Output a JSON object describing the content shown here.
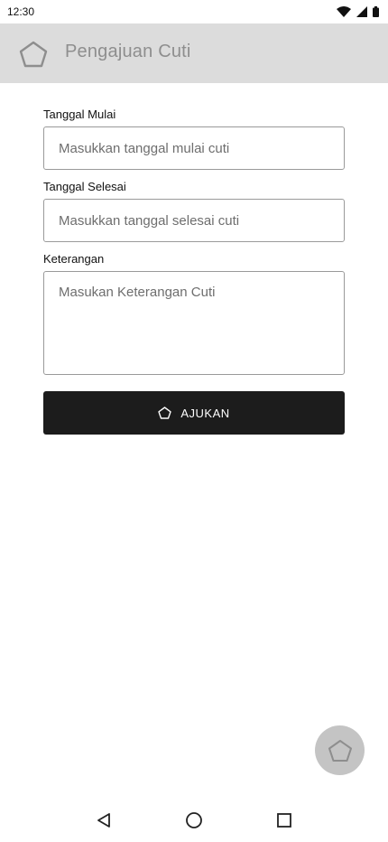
{
  "status_bar": {
    "time": "12:30",
    "icons": [
      "wifi-icon",
      "signal-icon",
      "battery-icon"
    ]
  },
  "app_bar": {
    "title": "Pengajuan Cuti",
    "icon": "pentagon-icon",
    "background": "#dcdcdc"
  },
  "form": {
    "start_date": {
      "label": "Tanggal Mulai",
      "placeholder": "Masukkan tanggal mulai cuti"
    },
    "end_date": {
      "label": "Tanggal Selesai",
      "placeholder": "Masukkan tanggal selesai cuti"
    },
    "notes": {
      "label": "Keterangan",
      "placeholder": "Masukan Keterangan Cuti"
    },
    "submit_label": "AJUKAN",
    "submit_color": "#1c1c1c"
  },
  "fab": {
    "icon": "pentagon-icon",
    "color": "#c4c4c4"
  },
  "nav_bar": {
    "icons": [
      "back-triangle-icon",
      "home-circle-icon",
      "recents-square-icon"
    ]
  }
}
